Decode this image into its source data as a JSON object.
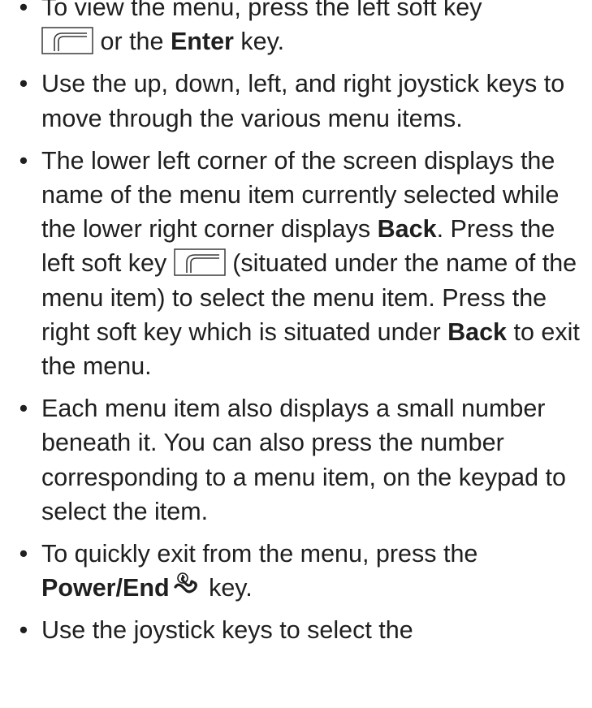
{
  "bullet_glyph": "•",
  "items": [
    {
      "t1": "To view the menu, press the left soft key",
      "t2": "or the ",
      "b1": "Enter",
      "t3": " key."
    },
    {
      "t1": "Use the up, down, left, and right joystick keys to move through the various menu items."
    },
    {
      "t1": "The lower left corner of the screen displays the name of the menu item currently selected while the lower right corner displays ",
      "b1": "Back",
      "t2": ". Press the left soft key",
      "t3": "(situated under the name of the menu item) to select the menu item. Press the right soft key which is situated under ",
      "b2": "Back",
      "t4": " to exit the menu."
    },
    {
      "t1": "Each menu item also displays a small number beneath it. You can also press the number corresponding to a menu item, on the keypad to select the item."
    },
    {
      "t1": "To quickly exit from the menu, press the ",
      "b1": "Power/End",
      "t2": " key."
    },
    {
      "t1": "Use the joystick keys to select the"
    }
  ],
  "icons": {
    "left_soft_key": "left-soft-key-icon",
    "power_end_key": "power-end-key-icon"
  }
}
